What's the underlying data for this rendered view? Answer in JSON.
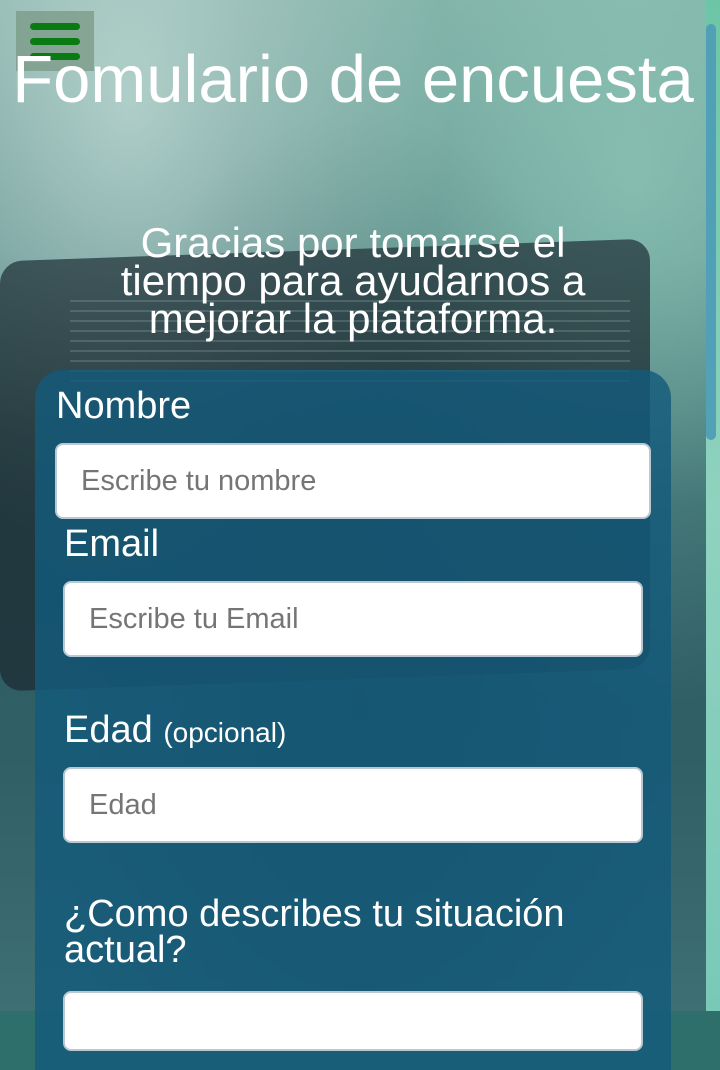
{
  "menu": {
    "icon": "hamburger-menu-icon"
  },
  "header": {
    "title": "Fomulario de encuesta",
    "subtitle": "Gracias por tomarse el tiempo para ayudarnos a mejorar la plataforma."
  },
  "form": {
    "name": {
      "label": "Nombre",
      "placeholder": "Escribe tu nombre",
      "value": ""
    },
    "email": {
      "label": "Email",
      "placeholder": "Escribe tu Email",
      "value": ""
    },
    "age": {
      "label": "Edad",
      "optional": "(opcional)",
      "placeholder": "Edad",
      "value": ""
    },
    "situation": {
      "label": "¿Como describes tu situación actual?"
    }
  },
  "colors": {
    "menu_icon": "#0a7a12",
    "form_background": "#135a7b",
    "text": "#ffffff"
  }
}
